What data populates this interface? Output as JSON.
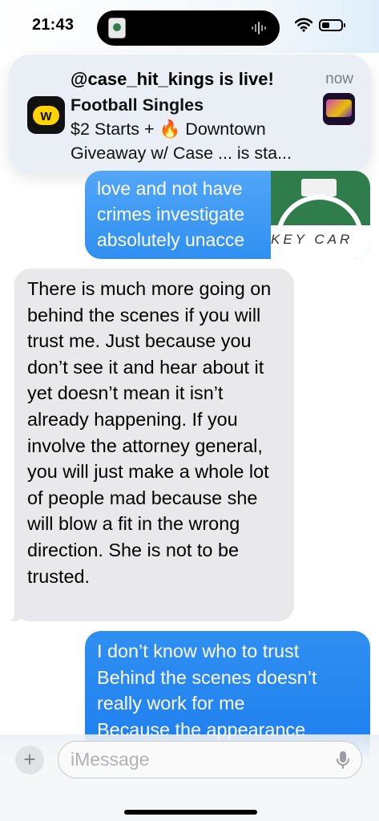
{
  "status_bar": {
    "time": "21:43"
  },
  "notification": {
    "title": "@case_hit_kings is live!",
    "time": "now",
    "body_line1": "Football Singles",
    "body_line2": "$2 Starts + 🔥 Downtown",
    "body_line3": "Giveaway w/ Case ... is sta...",
    "app_icon_letter": "w",
    "app_icon_color": "#ffd400"
  },
  "conversation": {
    "sent_partial_lines": [
      "love and not have",
      "crimes investigate",
      "absolutely unacce"
    ],
    "link_preview_caption": "KEY CAR",
    "received_message": "There is much more going on behind the scenes if you will trust me. Just because you don’t see it and hear about it yet doesn’t mean it isn’t already happening. If you involve the attorney general, you will just make a whole lot of people mad because she will blow a fit in the wrong direction. She is not to be trusted.",
    "sent_message_lines": [
      "I don’t know who to trust",
      "Behind the scenes doesn’t",
      "really work for me",
      "Because the appearance"
    ],
    "sent_bubble_color": "#2f8ff1",
    "received_bubble_color": "#e9e9eb"
  },
  "input_bar": {
    "placeholder": "iMessage",
    "plus_label": "+"
  }
}
